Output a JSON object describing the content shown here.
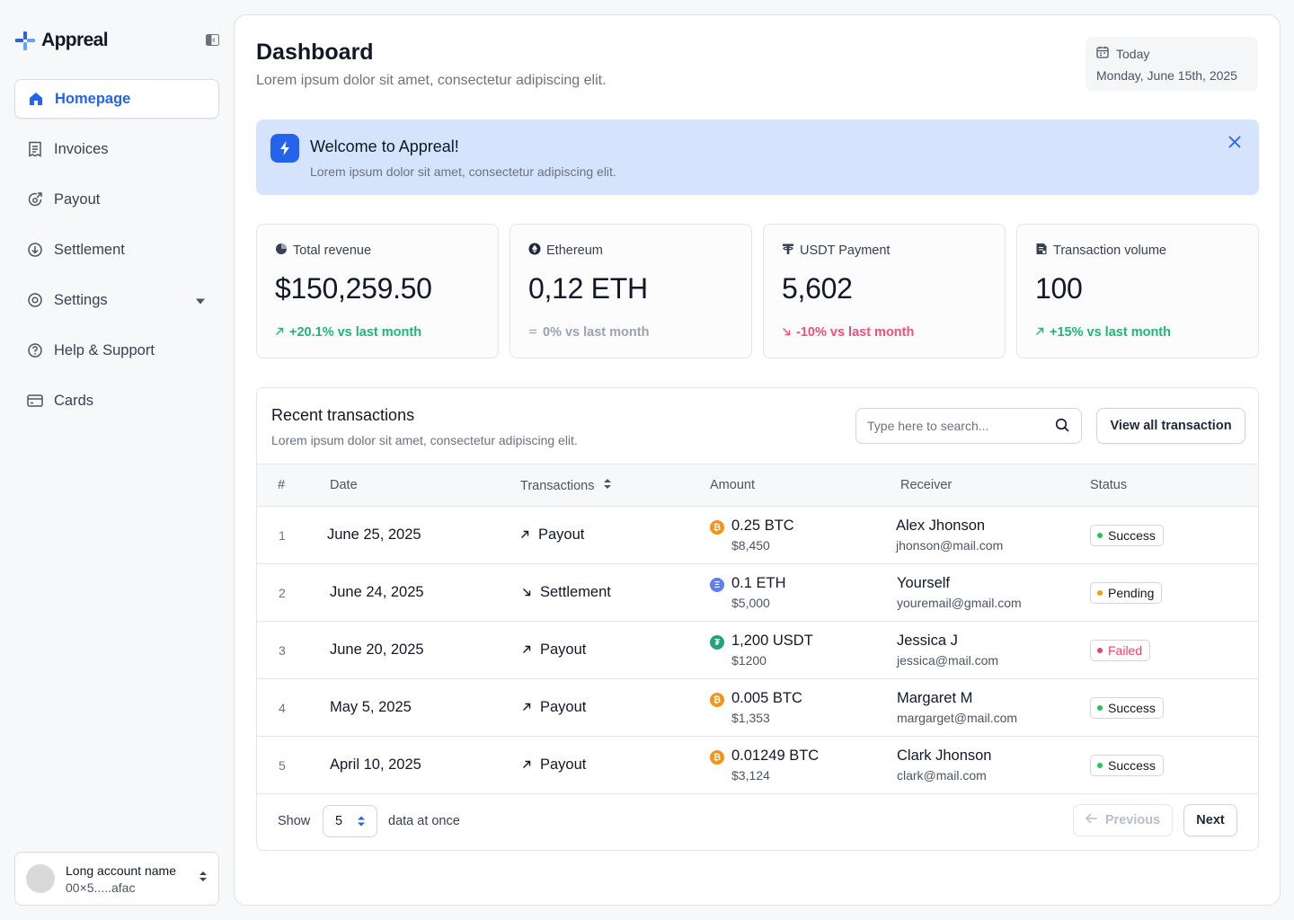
{
  "app": {
    "name": "Appreal"
  },
  "sidebar": {
    "items": [
      {
        "label": "Homepage",
        "icon": "home-icon",
        "active": true
      },
      {
        "label": "Invoices",
        "icon": "receipt-icon"
      },
      {
        "label": "Payout",
        "icon": "payout-icon"
      },
      {
        "label": "Settlement",
        "icon": "settlement-icon"
      },
      {
        "label": "Settings",
        "icon": "gear-icon",
        "has_dropdown": true
      },
      {
        "label": "Help & Support",
        "icon": "help-icon"
      },
      {
        "label": "Cards",
        "icon": "card-icon"
      }
    ],
    "account": {
      "name": "Long account name",
      "address": "00×5.....afac"
    }
  },
  "header": {
    "title": "Dashboard",
    "subtitle": "Lorem ipsum dolor sit amet, consectetur adipiscing elit.",
    "date_label": "Today",
    "date_value": "Monday, June 15th, 2025"
  },
  "banner": {
    "title": "Welcome to Appreal!",
    "subtitle": "Lorem ipsum dolor sit amet, consectetur adipiscing elit."
  },
  "stats": [
    {
      "label": "Total revenue",
      "value": "$150,259.50",
      "change": "+20.1% vs last month",
      "trend": "up"
    },
    {
      "label": "Ethereum",
      "value": "0,12 ETH",
      "change": "0% vs last month",
      "trend": "flat"
    },
    {
      "label": "USDT Payment",
      "value": "5,602",
      "change": "-10% vs last month",
      "trend": "down"
    },
    {
      "label": "Transaction volume",
      "value": "100",
      "change": "+15% vs last month",
      "trend": "up"
    }
  ],
  "transactions": {
    "title": "Recent transactions",
    "subtitle": "Lorem ipsum dolor sit amet, consectetur adipiscing elit.",
    "search_placeholder": "Type here to search...",
    "view_all_label": "View all transaction",
    "columns": {
      "num": "#",
      "date": "Date",
      "type": "Transactions",
      "amount": "Amount",
      "receiver": "Receiver",
      "status": "Status"
    },
    "rows": [
      {
        "num": "1",
        "date": "June 25, 2025",
        "type": "Payout",
        "direction": "out",
        "coin": "BTC",
        "amount": "0.25 BTC",
        "fiat": "$8,450",
        "receiver": "Alex Jhonson",
        "email": "jhonson@mail.com",
        "status": "Success"
      },
      {
        "num": "2",
        "date": "June 24, 2025",
        "type": "Settlement",
        "direction": "in",
        "coin": "ETH",
        "amount": "0.1 ETH",
        "fiat": "$5,000",
        "receiver": "Yourself",
        "email": "youremail@gmail.com",
        "status": "Pending"
      },
      {
        "num": "3",
        "date": "June 20, 2025",
        "type": "Payout",
        "direction": "out",
        "coin": "USDT",
        "amount": "1,200 USDT",
        "fiat": "$1200",
        "receiver": "Jessica J",
        "email": "jessica@mail.com",
        "status": "Failed"
      },
      {
        "num": "4",
        "date": "May 5, 2025",
        "type": "Payout",
        "direction": "out",
        "coin": "BTC",
        "amount": "0.005 BTC",
        "fiat": "$1,353",
        "receiver": "Margaret M",
        "email": "margarget@mail.com",
        "status": "Success"
      },
      {
        "num": "5",
        "date": "April 10, 2025",
        "type": "Payout",
        "direction": "out",
        "coin": "BTC",
        "amount": "0.01249 BTC",
        "fiat": "$3,124",
        "receiver": "Clark Jhonson",
        "email": "clark@mail.com",
        "status": "Success"
      }
    ],
    "footer": {
      "show_label": "Show",
      "page_size": "5",
      "suffix": "data at once",
      "prev_label": "Previous",
      "next_label": "Next"
    }
  },
  "colors": {
    "accent": "#2563eb",
    "success": "#22c55e",
    "pending": "#f59e0b",
    "failed": "#f43f5e",
    "btc": "#f7931a",
    "eth": "#627eea",
    "usdt": "#26a17b"
  }
}
